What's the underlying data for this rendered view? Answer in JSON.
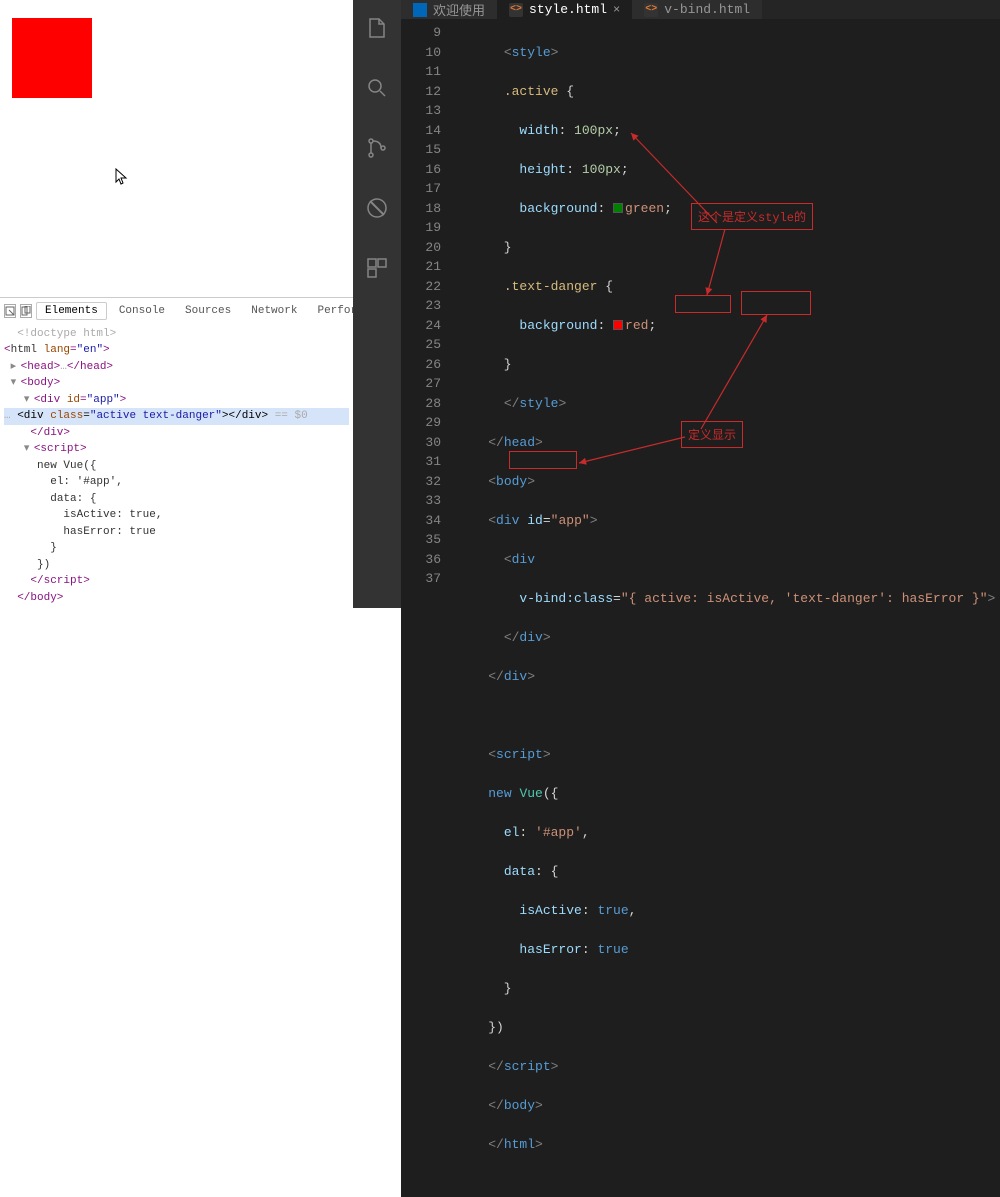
{
  "preview": {
    "boxClass": "active text-danger"
  },
  "devtools": {
    "tabs": {
      "elements": "Elements",
      "console": "Console",
      "sources": "Sources",
      "network": "Network",
      "performance": "Perform"
    },
    "dom": {
      "doctype": "<!doctype html>",
      "htmlOpen": "html",
      "htmlLang": "en",
      "headEllipsis": "…",
      "bodyTag": "body",
      "divId": "app",
      "innerDivClass": "active text-danger",
      "eqDollar": " == $0",
      "scriptTag": "script",
      "vue1": "new Vue({",
      "vue2": "  el: '#app',",
      "vue3": "  data: {",
      "vue4": "    isActive: true,",
      "vue5": "    hasError: true",
      "vue6": "  }",
      "vue7": "})"
    }
  },
  "vscode": {
    "tabs": {
      "welcome": "欢迎使用",
      "style": "style.html",
      "vbind": "v-bind.html"
    },
    "lines": {
      "9": "      <style>",
      "10": "      .active {",
      "11": "        width: 100px;",
      "12": "        height: 100px;",
      "13": "        background: green;",
      "14": "      }",
      "15": "      .text-danger {",
      "16": "        background: red;",
      "17": "      }",
      "18": "      </style>",
      "19": "    </head>",
      "20": "    <body>",
      "21": "    <div id=\"app\">",
      "22": "      <div",
      "23": "        v-bind:class=\"{ active: isActive, 'text-danger': hasError }\">",
      "24": "      </div>",
      "25": "    </div>",
      "26": "",
      "27": "    <script>",
      "28": "    new Vue({",
      "29": "      el: '#app',",
      "30": "      data: {",
      "31": "        isActive: true,",
      "32": "        hasError: true",
      "33": "      }",
      "34": "    })",
      "35": "    </script>",
      "36": "    </body>",
      "37": "    </html>"
    }
  },
  "annotations": {
    "styleDef": "这个是定义style的",
    "displayDef": "定义显示"
  },
  "colors": {
    "annotation": "#c92b2b",
    "previewBox": "#ff0000",
    "activeBg": "green",
    "dangerBg": "red"
  }
}
